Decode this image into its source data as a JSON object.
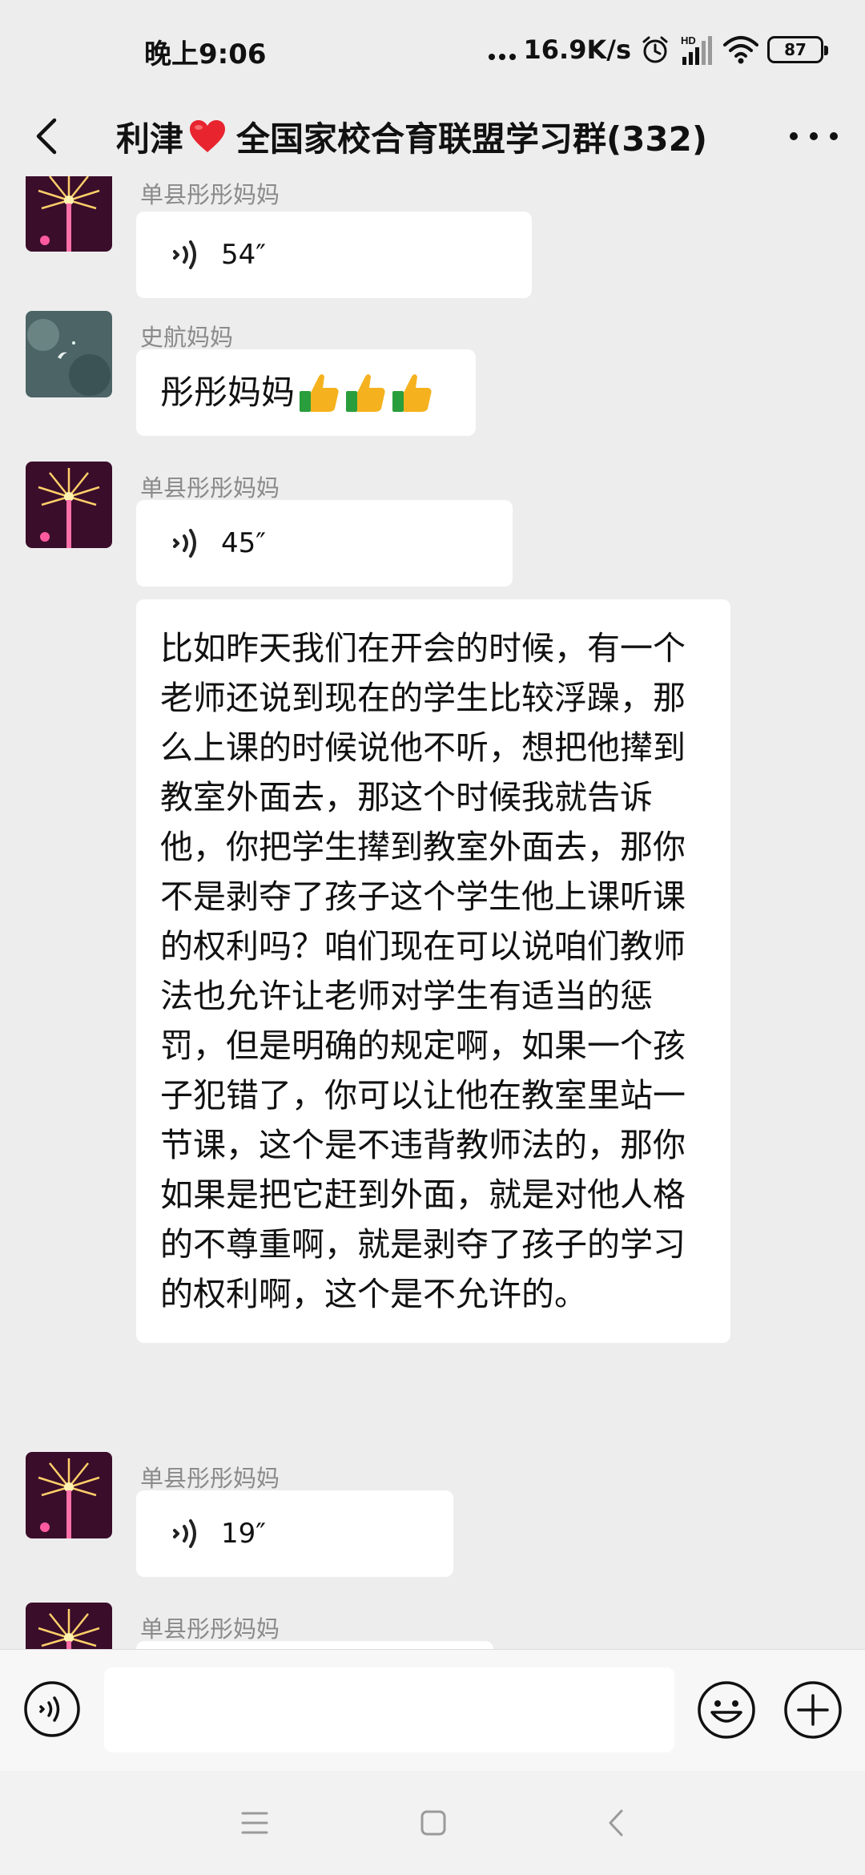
{
  "status_bar": {
    "time": "晚上9:06",
    "net_speed": "16.9K/s",
    "hd_label": "HD",
    "battery": "87",
    "icons": [
      "dots-icon",
      "alarm-icon",
      "signal-icon",
      "wifi-icon",
      "battery-icon"
    ]
  },
  "header": {
    "title_prefix": "利津",
    "title_suffix": "全国家校合育联盟学习群(332)",
    "icons": [
      "back-arrow-icon",
      "heart-icon",
      "more-icon"
    ]
  },
  "messages": [
    {
      "type": "voice",
      "sender": "单县彤彤妈妈",
      "duration": "54″"
    },
    {
      "type": "text",
      "sender": "史航妈妈",
      "text": "彤彤妈妈",
      "emoji": [
        "thumbs-up-icon",
        "thumbs-up-icon",
        "thumbs-up-icon"
      ]
    },
    {
      "type": "voice",
      "sender": "单县彤彤妈妈",
      "duration": "45″"
    },
    {
      "type": "text",
      "sender": "单县彤彤妈妈",
      "text": "比如昨天我们在开会的时候，有一个老师还说到现在的学生比较浮躁，那么上课的时候说他不听，想把他撵到教室外面去，那这个时候我就告诉他，你把学生撵到教室外面去，那你不是剥夺了孩子这个学生他上课听课的权利吗？咱们现在可以说咱们教师法也允许让老师对学生有适当的惩罚，但是明确的规定啊，如果一个孩子犯错了，你可以让他在教室里站一节课，这个是不违背教师法的，那你如果是把它赶到外面，就是对他人格的不尊重啊，就是剥夺了孩子的学习的权利啊，这个是不允许的。"
    },
    {
      "type": "voice",
      "sender": "单县彤彤妈妈",
      "duration": "19″"
    },
    {
      "type": "voice",
      "sender": "单县彤彤妈妈",
      "duration": ""
    }
  ],
  "input_bar": {
    "placeholder": "",
    "icons": [
      "voice-toggle-icon",
      "emoji-icon",
      "plus-icon"
    ]
  },
  "system_nav": {
    "icons": [
      "menu-icon",
      "home-icon",
      "back-icon"
    ]
  },
  "colors": {
    "background": "#ededed",
    "bubble": "#ffffff",
    "sender_name": "#8a8a8a",
    "heart": "#e8242f",
    "thumb_yellow": "#f5b21e",
    "thumb_green": "#2a9d3c"
  }
}
